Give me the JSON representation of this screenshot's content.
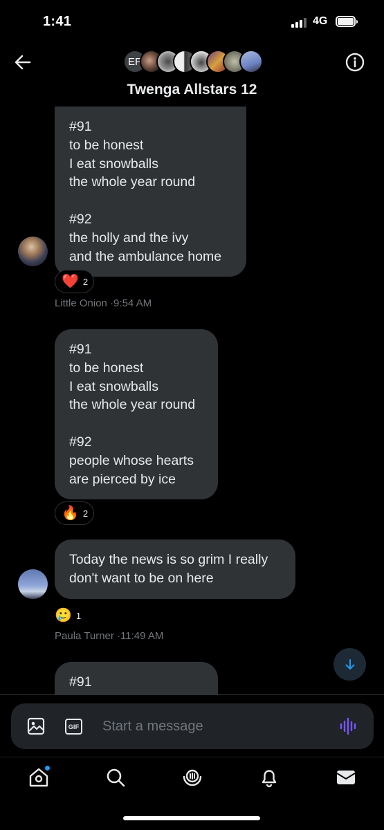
{
  "status_bar": {
    "time": "1:41",
    "network": "4G"
  },
  "header": {
    "title": "Twenga Allstars 12",
    "avatar_initials": "EP"
  },
  "messages": [
    {
      "lines": [
        "#91",
        "to be honest",
        "I eat snowballs",
        "the whole year round",
        "",
        "#92",
        "the holly and the ivy",
        "and the ambulance home"
      ],
      "reaction": {
        "emoji": "❤️",
        "count": "2"
      },
      "sender": "Little Onion",
      "time": "·9:54 AM"
    },
    {
      "lines": [
        "#91",
        "to be honest",
        "I eat snowballs",
        "the whole year round",
        "",
        "#92",
        "people whose hearts",
        "are pierced by ice"
      ],
      "reaction": {
        "emoji": "🔥",
        "count": "2"
      }
    },
    {
      "lines": [
        "Today the news is so grim I really",
        "don't want to be on here"
      ],
      "reaction": {
        "emoji": "🥲",
        "count": "1"
      },
      "sender": "Paula Turner",
      "time": "·11:49 AM"
    },
    {
      "lines": [
        "#91"
      ]
    }
  ],
  "composer": {
    "placeholder": "Start a message",
    "gif_label": "GIF"
  },
  "colors": {
    "bubble": "#2f3336",
    "accent": "#1d9bf0",
    "voice": "#7856ff",
    "background": "#000000"
  },
  "nav": {
    "items": [
      "home-icon",
      "search-icon",
      "grok-icon",
      "notifications-icon",
      "messages-icon"
    ]
  }
}
